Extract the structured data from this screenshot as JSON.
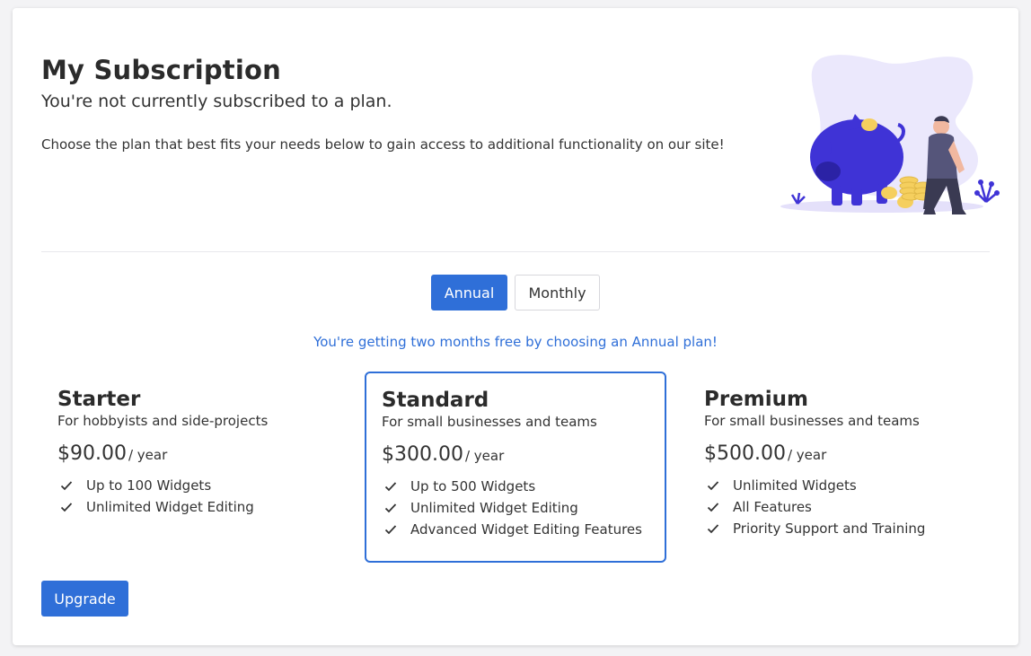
{
  "header": {
    "title": "My Subscription",
    "subtitle": "You're not currently subscribed to a plan.",
    "description": "Choose the plan that best fits your needs below to gain access to additional functionality on our site!"
  },
  "billing_toggle": {
    "annual_label": "Annual",
    "monthly_label": "Monthly",
    "selected": "Annual"
  },
  "promo_text": "You're getting two months free by choosing an Annual plan!",
  "plans": [
    {
      "name": "Starter",
      "tagline": "For hobbyists and side-projects",
      "price": "$90.00",
      "period": "/ year",
      "features": [
        "Up to 100 Widgets",
        "Unlimited Widget Editing"
      ],
      "selected": false
    },
    {
      "name": "Standard",
      "tagline": "For small businesses and teams",
      "price": "$300.00",
      "period": "/ year",
      "features": [
        "Up to 500 Widgets",
        "Unlimited Widget Editing",
        "Advanced Widget Editing Features"
      ],
      "selected": true
    },
    {
      "name": "Premium",
      "tagline": "For small businesses and teams",
      "price": "$500.00",
      "period": "/ year",
      "features": [
        "Unlimited Widgets",
        "All Features",
        "Priority Support and Training"
      ],
      "selected": false
    }
  ],
  "upgrade_label": "Upgrade",
  "icons": {
    "feature": "check-icon",
    "illustration": "piggy-bank-illustration"
  },
  "colors": {
    "accent": "#2f6fd8",
    "illustration_primary": "#3f33d6",
    "illustration_bg": "#ebe8fc",
    "coin": "#f5cf5e"
  }
}
